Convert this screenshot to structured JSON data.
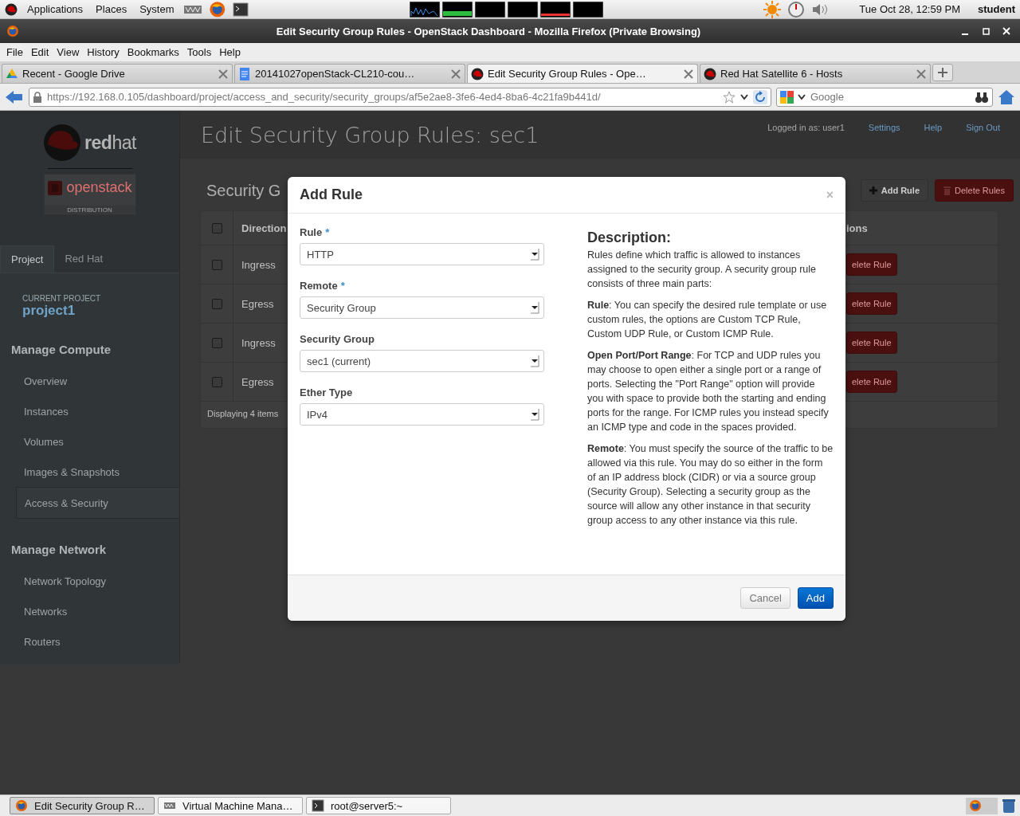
{
  "top_panel": {
    "menus": [
      "Applications",
      "Places",
      "System"
    ],
    "clock": "Tue Oct 28, 12:59 PM",
    "user": "student"
  },
  "window": {
    "title": "Edit Security Group Rules - OpenStack Dashboard - Mozilla Firefox (Private Browsing)"
  },
  "menu_bar": [
    "File",
    "Edit",
    "View",
    "History",
    "Bookmarks",
    "Tools",
    "Help"
  ],
  "tabs": [
    {
      "label": "Recent - Google Drive",
      "selected": false
    },
    {
      "label": "20141027openStack-CL210-cou…",
      "selected": false
    },
    {
      "label": "Edit Security Group Rules - Ope…",
      "selected": true
    },
    {
      "label": "Red Hat Satellite 6 - Hosts",
      "selected": false
    }
  ],
  "address_bar": {
    "url": "https://192.168.0.105/dashboard/project/access_and_security/security_groups/af5e2ae8-3fe6-4ed4-8ba6-4c21fa9b441d/"
  },
  "search": {
    "placeholder": "Google"
  },
  "dashboard": {
    "brand": "**red**hat",
    "product": "openstack",
    "product_note": "DISTRIBUTION",
    "user_info": "Logged in as: user1",
    "header_links": [
      "Settings",
      "Help",
      "Sign Out"
    ],
    "title": "Edit Security Group Rules: sec1",
    "sidebar_tabs": [
      {
        "label": "Project",
        "selected": true
      },
      {
        "label": "Red Hat",
        "selected": false
      }
    ],
    "current_project_label": "CURRENT PROJECT",
    "current_project": "project1",
    "sections": [
      {
        "heading": "Manage Compute",
        "items": [
          {
            "label": "Overview",
            "selected": false
          },
          {
            "label": "Instances",
            "selected": false
          },
          {
            "label": "Volumes",
            "selected": false
          },
          {
            "label": "Images & Snapshots",
            "selected": false
          },
          {
            "label": "Access & Security",
            "selected": true
          }
        ]
      },
      {
        "heading": "Manage Network",
        "items": [
          {
            "label": "Network Topology",
            "selected": false
          },
          {
            "label": "Networks",
            "selected": false
          },
          {
            "label": "Routers",
            "selected": false
          }
        ]
      }
    ],
    "section_title": "Security G",
    "toolbar_buttons": [
      {
        "label": "Add Rule",
        "kind": "add"
      },
      {
        "label": "Delete Rules",
        "kind": "delete"
      }
    ],
    "table": {
      "header_checked": false,
      "columns": [
        "Direction",
        "ions"
      ],
      "rows": [
        {
          "checked": false,
          "direction": "Ingress",
          "action": "elete Rule"
        },
        {
          "checked": false,
          "direction": "Egress",
          "action": "elete Rule"
        },
        {
          "checked": false,
          "direction": "Ingress",
          "action": "elete Rule"
        },
        {
          "checked": false,
          "direction": "Egress",
          "action": "elete Rule"
        }
      ],
      "footer": "Displaying 4 items"
    }
  },
  "modal": {
    "title": "Add Rule",
    "close": "×",
    "required_mark": "*",
    "fields": [
      {
        "label": "Rule",
        "required": true,
        "value": "HTTP"
      },
      {
        "label": "Remote",
        "required": true,
        "value": "Security Group"
      },
      {
        "label": "Security Group",
        "required": false,
        "value": "sec1 (current)"
      },
      {
        "label": "Ether Type",
        "required": false,
        "value": "IPv4"
      }
    ],
    "description_heading": "Description:",
    "description": [
      "Rules define which traffic is allowed to instances assigned to the security group. A security group rule consists of three main parts:",
      "**Rule**: You can specify the desired rule template or use custom rules, the options are Custom TCP Rule, Custom UDP Rule, or Custom ICMP Rule.",
      "**Open Port/Port Range**: For TCP and UDP rules you may choose to open either a single port or a range of ports. Selecting the \"Port Range\" option will provide you with space to provide both the starting and ending ports for the range. For ICMP rules you instead specify an ICMP type and code in the spaces provided.",
      "**Remote**: You must specify the source of the traffic to be allowed via this rule. You may do so either in the form of an IP address block (CIDR) or via a source group (Security Group). Selecting a security group as the source will allow any other instance in that security group access to any other instance via this rule."
    ],
    "buttons": [
      {
        "label": "Cancel",
        "kind": "secondary"
      },
      {
        "label": "Add",
        "kind": "primary"
      }
    ]
  },
  "taskbar": [
    {
      "label": "Edit Security Group R…",
      "selected": true
    },
    {
      "label": "Virtual Machine Mana…",
      "selected": false
    },
    {
      "label": "root@server5:~",
      "selected": false
    }
  ]
}
